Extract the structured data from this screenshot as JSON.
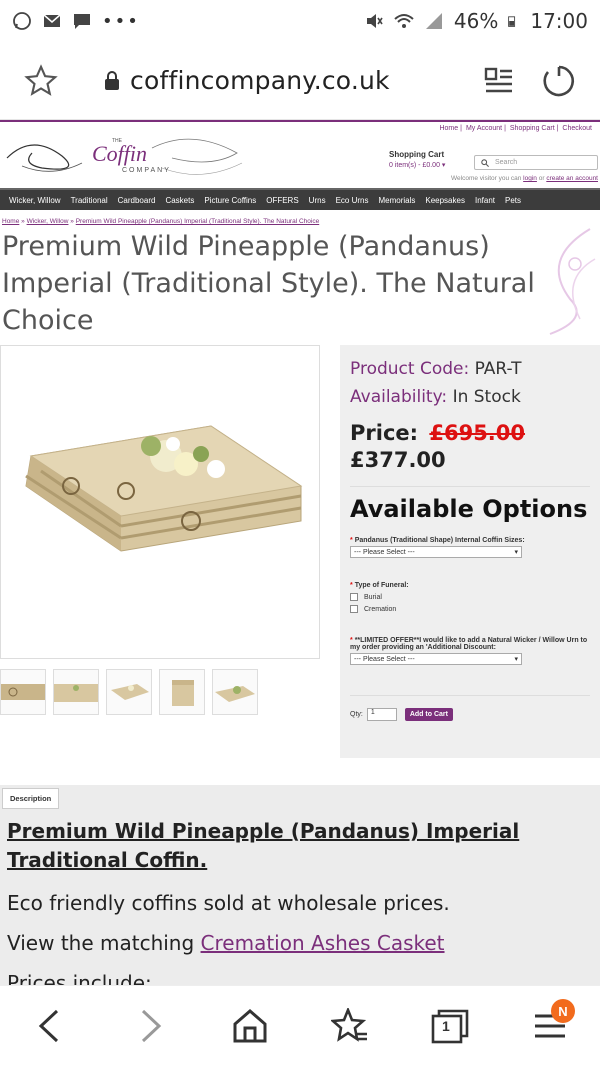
{
  "status_bar": {
    "battery": "46%",
    "time": "17:00"
  },
  "browser": {
    "url": "coffincompany.co.uk"
  },
  "site": {
    "top_links": [
      "Home",
      "My Account",
      "Shopping Cart",
      "Checkout"
    ],
    "cart": {
      "title": "Shopping Cart",
      "count": "0 item(s) - £0.00"
    },
    "search_placeholder": "Search",
    "welcome_prefix": "Welcome visitor you can",
    "login": "login",
    "or": "or",
    "create_account": "create an account"
  },
  "nav": [
    "Wicker, Willow",
    "Traditional",
    "Cardboard",
    "Caskets",
    "Picture Coffins",
    "OFFERS",
    "Urns",
    "Eco Urns",
    "Memorials",
    "Keepsakes",
    "Infant",
    "Pets"
  ],
  "breadcrumb": [
    "Home",
    "Wicker, Willow",
    "Premium Wild Pineapple (Pandanus) Imperial (Traditional Style). The Natural Choice"
  ],
  "product": {
    "title": "Premium Wild Pineapple (Pandanus) Imperial (Traditional Style). The Natural Choice",
    "code_label": "Product Code:",
    "code": "PAR-T",
    "availability_label": "Availability:",
    "availability": "In Stock",
    "price_label": "Price:",
    "old_price": "£695.00",
    "new_price": "£377.00",
    "options_title": "Available Options",
    "option1_label": "Pandanus (Traditional Shape) Internal Coffin Sizes:",
    "option1_value": "--- Please Select ---",
    "option2_label": "Type of Funeral:",
    "option2_choices": [
      "Burial",
      "Cremation"
    ],
    "option3_label": "**LIMITED OFFER**I would like to add a Natural Wicker / Willow Urn to my order providing an 'Additional Discount:",
    "option3_value": "--- Please Select ---",
    "qty_label": "Qty:",
    "qty_value": "1",
    "add_to_cart": "Add to Cart"
  },
  "description": {
    "tab": "Description",
    "heading": "Premium Wild Pineapple (Pandanus) Imperial Traditional Coffin.",
    "line1": "Eco friendly coffins sold at wholesale prices.",
    "line2_prefix": "View the matching",
    "line2_link": "Cremation Ashes Casket",
    "line3": "Prices include:"
  },
  "bottom_bar": {
    "tabs_count": "1",
    "badge": "N"
  },
  "colors": {
    "brand_purple": "#7b2f7b",
    "price_red": "#dd1111",
    "nav_bg": "#3c3c3c",
    "badge_orange": "#f26b1d"
  }
}
